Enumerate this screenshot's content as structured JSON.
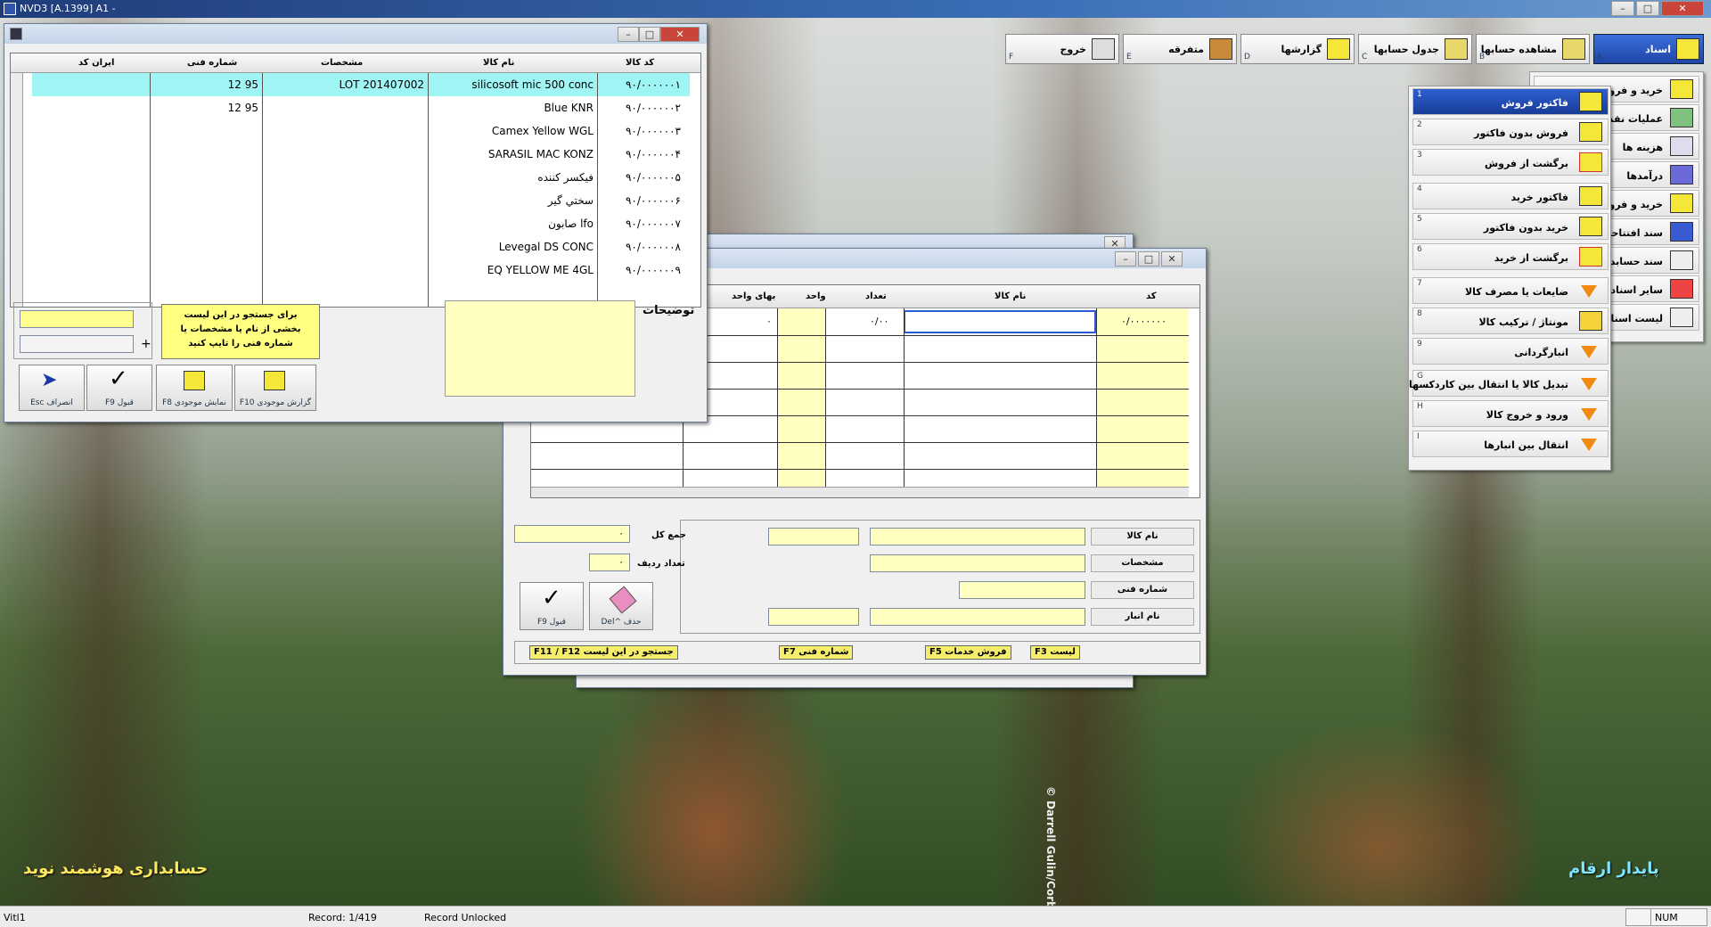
{
  "app": {
    "title": "NVD3 [A.1399] A1 -"
  },
  "toolbar": [
    {
      "label": "اسناد",
      "key": "A"
    },
    {
      "label": "مشاهده حسابها",
      "key": "B"
    },
    {
      "label": "جدول حسابها",
      "key": "C"
    },
    {
      "label": "گزارشها",
      "key": "D"
    },
    {
      "label": "متفرقه",
      "key": "E"
    },
    {
      "label": "خروج",
      "key": "F"
    }
  ],
  "side_menu": [
    "خرید و فروش",
    "عملیات نقدی",
    "هزینه ها",
    "درآمدها",
    "خرید و فروش",
    "سند افتتاحیه",
    "سند حسابداری",
    "سایر اسناد",
    "لیست اسناد"
  ],
  "submenu": [
    {
      "num": "1",
      "label": "فاکتور فروش"
    },
    {
      "num": "2",
      "label": "فروش بدون فاکتور"
    },
    {
      "num": "3",
      "label": "برگشت از فروش"
    },
    {
      "num": "4",
      "label": "فاکتور خرید"
    },
    {
      "num": "5",
      "label": "خرید بدون فاکتور"
    },
    {
      "num": "6",
      "label": "برگشت از خرید"
    },
    {
      "num": "7",
      "label": "ضایعات یا مصرف کالا"
    },
    {
      "num": "8",
      "label": "مونتاژ / ترکیب کالا"
    },
    {
      "num": "9",
      "label": "انبارگردانی"
    },
    {
      "num": "G",
      "label": "تبدیل کالا یا انتقال بین کاردکسها"
    },
    {
      "num": "H",
      "label": "ورود و خروج کالا"
    },
    {
      "num": "I",
      "label": "انتقال بین انبارها"
    }
  ],
  "lookup": {
    "columns": {
      "code": "کد کالا",
      "name": "نام کالا",
      "spec": "مشخصات",
      "tech": "شماره فنی",
      "iran": "ایران کد"
    },
    "rows": [
      {
        "code": "۹۰/۰۰۰۰۰۰۱",
        "name": "silicosoft mic 500 conc",
        "spec": "LOT 201407002",
        "tech": "12 95"
      },
      {
        "code": "۹۰/۰۰۰۰۰۰۲",
        "name": "Blue KNR",
        "spec": "",
        "tech": "12 95"
      },
      {
        "code": "۹۰/۰۰۰۰۰۰۳",
        "name": "Camex Yellow WGL",
        "spec": "",
        "tech": ""
      },
      {
        "code": "۹۰/۰۰۰۰۰۰۴",
        "name": "SARASIL MAC KONZ",
        "spec": "",
        "tech": ""
      },
      {
        "code": "۹۰/۰۰۰۰۰۰۵",
        "name": "فیکسر کننده",
        "spec": "",
        "tech": ""
      },
      {
        "code": "۹۰/۰۰۰۰۰۰۶",
        "name": "سختي گير",
        "spec": "",
        "tech": ""
      },
      {
        "code": "۹۰/۰۰۰۰۰۰۷",
        "name": "صابون lfo",
        "spec": "",
        "tech": ""
      },
      {
        "code": "۹۰/۰۰۰۰۰۰۸",
        "name": "Levegal DS CONC",
        "spec": "",
        "tech": ""
      },
      {
        "code": "۹۰/۰۰۰۰۰۰۹",
        "name": "EQ YELLOW ME 4GL",
        "spec": "",
        "tech": ""
      }
    ],
    "notes_label": "توضیحات",
    "hint": "برای جستجو در این لیست بخشی از نام  یا مشخصات یا شماره فنی را تایپ کنید",
    "plus": "+",
    "buttons": [
      {
        "label": "F10  گزارش موجودی"
      },
      {
        "label": "F8 نمایش موجودی"
      },
      {
        "label": "F9  قبول"
      },
      {
        "label": "Esc  انصراف"
      }
    ]
  },
  "invoice": {
    "columns": {
      "code": "کد",
      "name": "نام کالا",
      "qty": "تعداد",
      "unit": "واحد",
      "price": "بهای واحد"
    },
    "first_row": {
      "code": "۰/۰۰۰۰۰۰۰",
      "qty": "۰/۰۰",
      "price": "۰"
    },
    "total_label": "جمع کل",
    "total_value": "۰",
    "rows_label": "تعداد ردیف",
    "rows_value": "۰",
    "labels": [
      "نام کالا",
      "مشخصات",
      "شماره فنی",
      "نام انبار"
    ],
    "del_btn": "Del^  حذف",
    "ok_btn": "F9  قبول",
    "hints": [
      "F3 لیست",
      "F5  فروش خدمات",
      "F7  شماره فنی",
      "F11 / F12  جستجو در این لیست"
    ]
  },
  "brand_left": "حسابداری هوشمند نوید",
  "brand_right": "پایدار ارقام",
  "watermark": "© Darrell Gulin/Corbis",
  "status": {
    "left": "Vitl1",
    "record": "Record: 1/419",
    "lock": "Record Unlocked",
    "num": "NUM"
  }
}
